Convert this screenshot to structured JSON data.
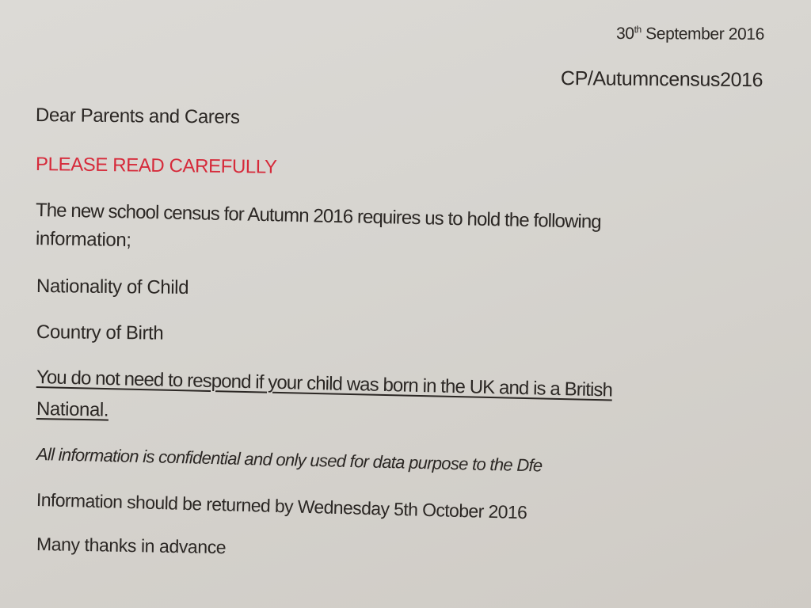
{
  "letter": {
    "date_day": "30",
    "date_suffix": "th",
    "date_rest": " September 2016",
    "reference": "CP/Autumncensus2016",
    "salutation": "Dear Parents and Carers",
    "warning": "PLEASE READ CAREFULLY",
    "intro_line1": "The new school census for Autumn 2016 requires us to hold the following",
    "intro_line2": "information;",
    "item1": "Nationality of Child",
    "item2": "Country of Birth",
    "notice_line1": "You do not need to respond if your child was born in the UK and is a British",
    "notice_line2": "National.",
    "confidential": "All information is confidential and only used for data purpose to the Dfe",
    "deadline": "Information should be returned by Wednesday 5th October 2016",
    "closing": "Many thanks in advance"
  },
  "colors": {
    "text": "#2b2724",
    "warning": "#d62a3a",
    "paper": "#d8d6d1"
  }
}
